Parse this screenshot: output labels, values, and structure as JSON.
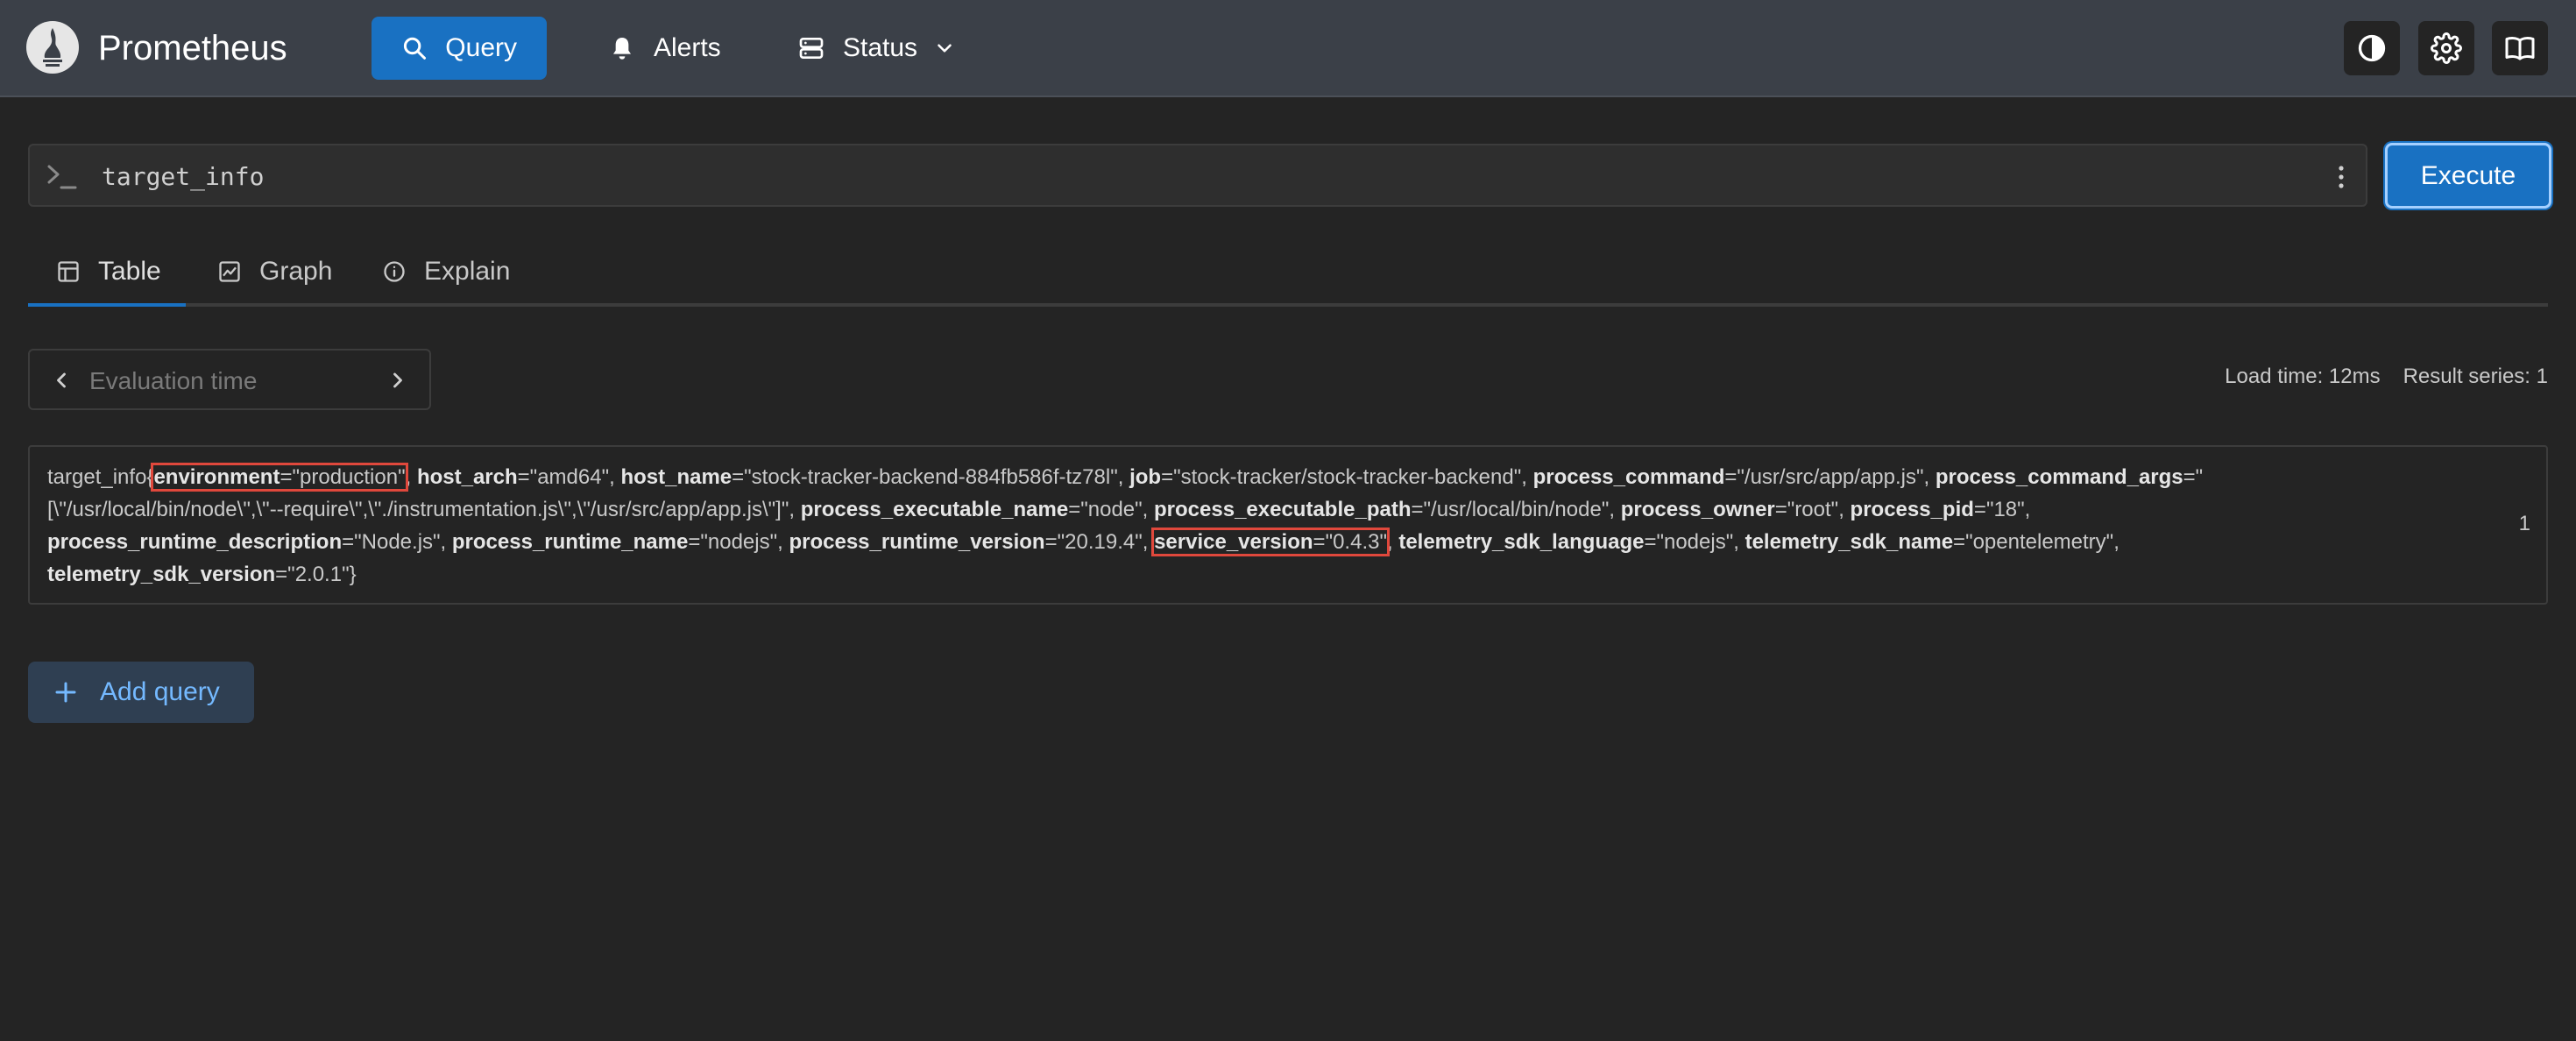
{
  "header": {
    "brand": "Prometheus",
    "nav": {
      "query": "Query",
      "alerts": "Alerts",
      "status": "Status"
    },
    "icons": [
      "theme-toggle-icon",
      "gear-icon",
      "book-icon"
    ]
  },
  "query": {
    "expression": "target_info",
    "execute_label": "Execute"
  },
  "tabs": {
    "table": "Table",
    "graph": "Graph",
    "explain": "Explain",
    "active": "Table"
  },
  "eval": {
    "placeholder": "Evaluation time"
  },
  "stats": {
    "load_time": "Load time: 12ms",
    "result_series": "Result series: 1"
  },
  "result": {
    "metric_name": "target_info",
    "labels": [
      {
        "name": "environment",
        "value": "production"
      },
      {
        "name": "host_arch",
        "value": "amd64"
      },
      {
        "name": "host_name",
        "value": "stock-tracker-backend-884fb586f-tz78l"
      },
      {
        "name": "job",
        "value": "stock-tracker/stock-tracker-backend"
      },
      {
        "name": "process_command",
        "value": "/usr/src/app/app.js"
      },
      {
        "name": "process_command_args",
        "value": "[\\\"/usr/local/bin/node\\\",\\\"--require\\\",\\\"./instrumentation.js\\\",\\\"/usr/src/app/app.js\\\"]"
      },
      {
        "name": "process_executable_name",
        "value": "node"
      },
      {
        "name": "process_executable_path",
        "value": "/usr/local/bin/node"
      },
      {
        "name": "process_owner",
        "value": "root"
      },
      {
        "name": "process_pid",
        "value": "18"
      },
      {
        "name": "process_runtime_description",
        "value": "Node.js"
      },
      {
        "name": "process_runtime_name",
        "value": "nodejs"
      },
      {
        "name": "process_runtime_version",
        "value": "20.19.4"
      },
      {
        "name": "service_version",
        "value": "0.4.3"
      },
      {
        "name": "telemetry_sdk_language",
        "value": "nodejs"
      },
      {
        "name": "telemetry_sdk_name",
        "value": "opentelemetry"
      },
      {
        "name": "telemetry_sdk_version",
        "value": "2.0.1"
      }
    ],
    "highlighted": [
      "environment",
      "service_version"
    ],
    "value": "1"
  },
  "add_query_label": "Add query",
  "colors": {
    "accent": "#1971c2",
    "highlight": "#e0483c",
    "background": "#242424",
    "header": "#3b4048"
  }
}
